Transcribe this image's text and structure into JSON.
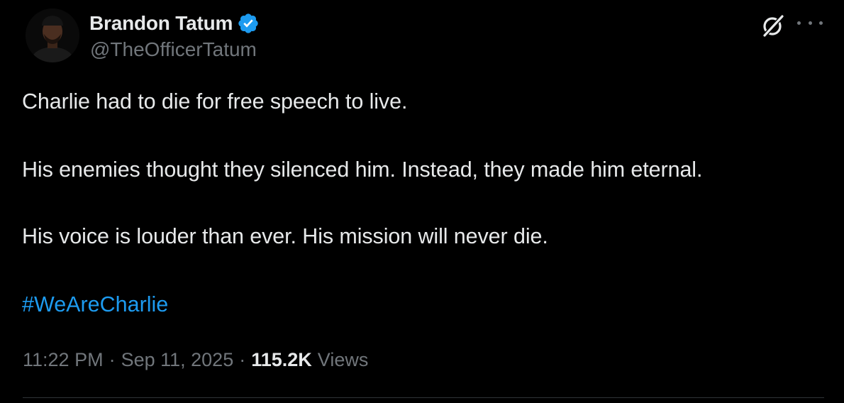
{
  "tweet": {
    "author": {
      "display_name": "Brandon Tatum",
      "handle": "@TheOfficerTatum",
      "verified_color": "#1d9bf0"
    },
    "icons": {
      "verified": "verified-badge-icon",
      "grok": "grok-icon",
      "more": "more-options-icon"
    },
    "lines": [
      "Charlie had to die for free speech to live.",
      "His enemies thought they silenced him. Instead, they made him eternal.",
      "His voice is louder than ever. His mission will never die."
    ],
    "hashtag": "#WeAreCharlie",
    "meta": {
      "time": "11:22 PM",
      "separator": "·",
      "date": "Sep 11, 2025",
      "views_count": "115.2K",
      "views_label": "Views"
    }
  },
  "colors": {
    "background": "#000000",
    "primary_text": "#e7e9ea",
    "secondary_text": "#71767b",
    "link": "#1d9bf0",
    "divider": "#2f3336"
  }
}
